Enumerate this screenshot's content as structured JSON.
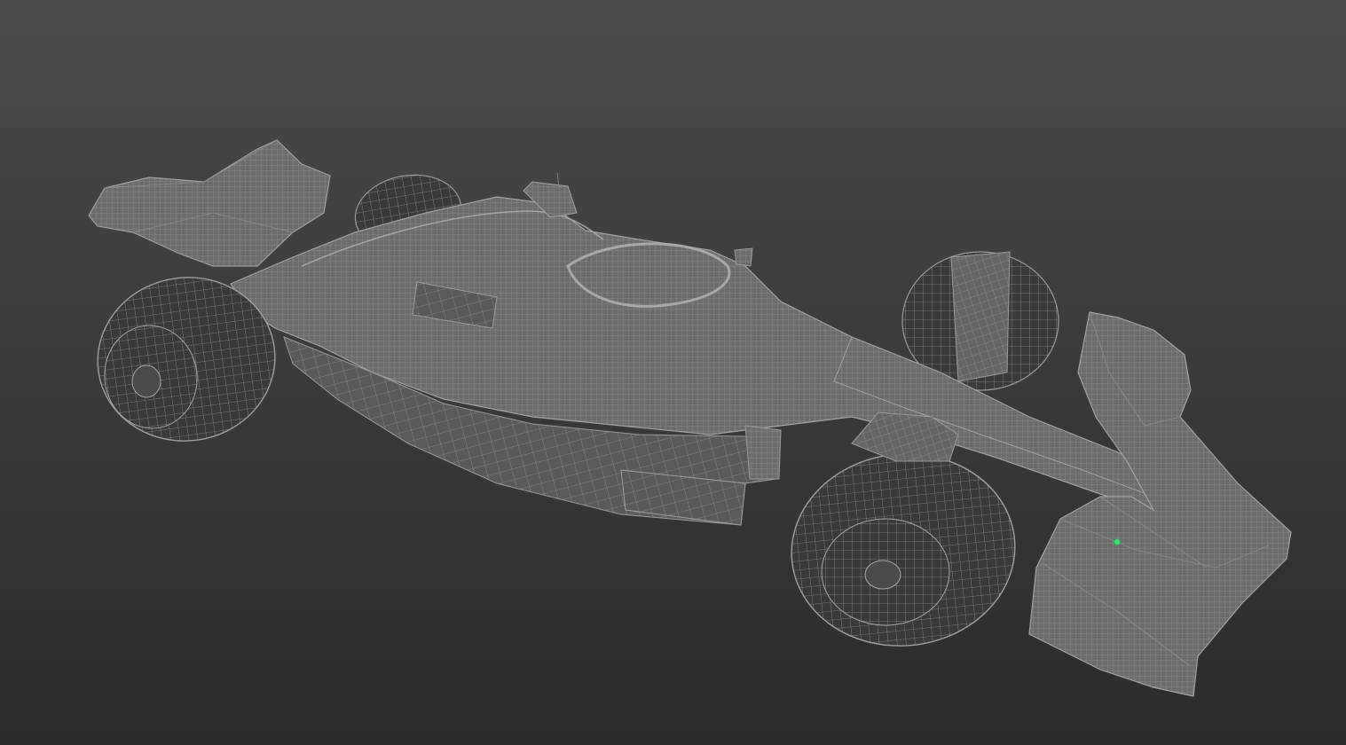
{
  "viewport": {
    "background_top": "#4a4a4a",
    "background_bottom": "#2b2b2b",
    "display_mode": "wireframe-on-shaded",
    "wire_color": "#8a8a8a",
    "shade_color": "#6f6f6f"
  },
  "model": {
    "subject": "formula-one-car",
    "parts": [
      "front-wing",
      "nose",
      "chassis",
      "halo",
      "sidepod",
      "floor",
      "rear-wing",
      "front-left-wheel",
      "front-right-wheel",
      "rear-left-wheel",
      "rear-right-wheel"
    ]
  },
  "pivot": {
    "color": "#2ee86a"
  }
}
